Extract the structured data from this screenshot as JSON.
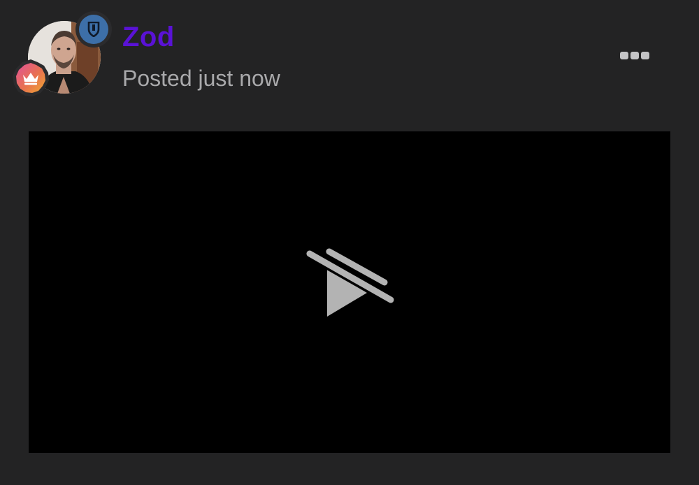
{
  "post": {
    "author_name": "Zod",
    "timestamp": "Posted just now"
  },
  "colors": {
    "background": "#232324",
    "author_name": "#5a12d6",
    "timestamp": "#a9a9ab",
    "shield_badge": "#3d6fa8",
    "video_background": "#000000",
    "video_icon": "#b3b3b3"
  },
  "icons": {
    "avatar": "user-photo",
    "top_badge": "shield-icon",
    "bottom_badge": "crown-icon",
    "menu": "more-options-icon",
    "video": "video-unavailable-icon"
  }
}
